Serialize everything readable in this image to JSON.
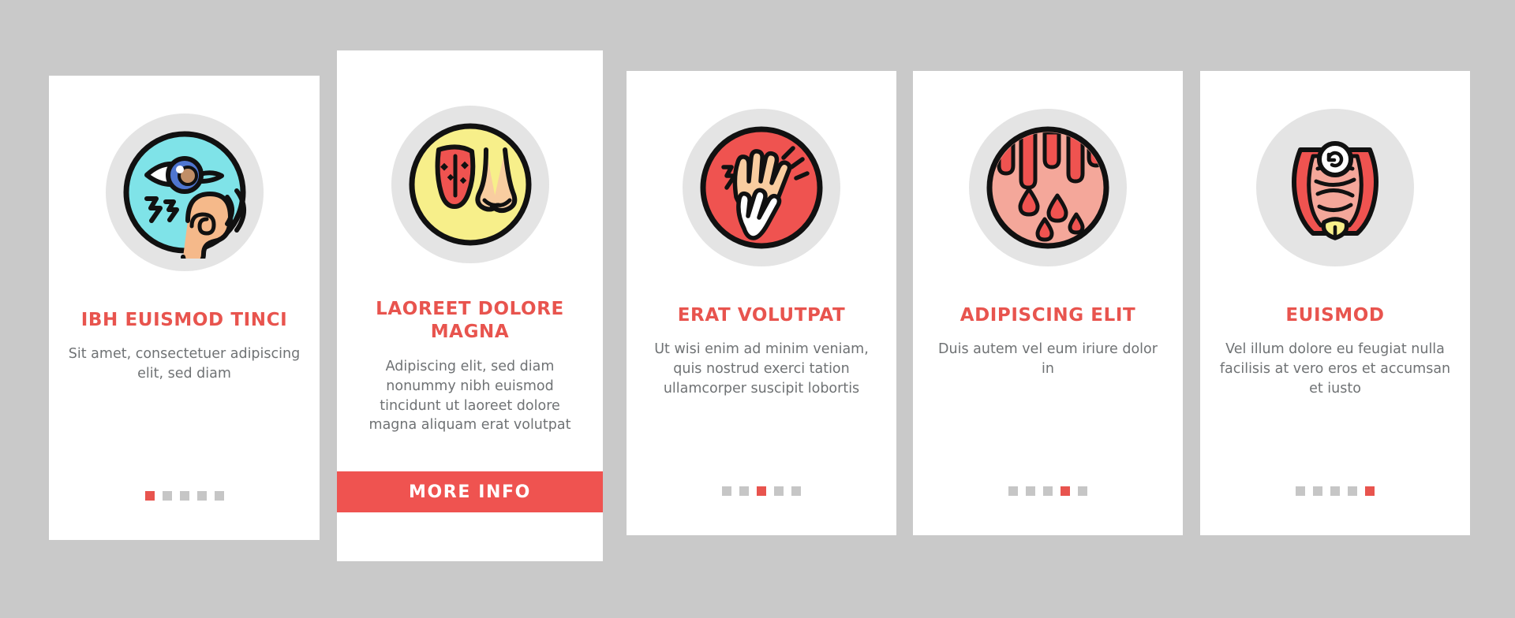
{
  "background_color": "#c9c9c9",
  "accent_color": "#e8544e",
  "button_color": "#ef5350",
  "text_color": "#6f7274",
  "icon_disc_color": "#e4e4e4",
  "cards": [
    {
      "id": "card-1",
      "icon_name": "eye-ear-sensory-icon",
      "icon_bg": "#7fe3e8",
      "title": "IBH EUISMOD TINCI",
      "description": "Sit amet, consectetuer adipiscing elit, sed diam",
      "featured": false,
      "pagination": {
        "total": 5,
        "active_index": 0
      }
    },
    {
      "id": "card-2",
      "icon_name": "tongue-nose-icon",
      "icon_bg": "#f7ef8a",
      "title": "LAOREET DOLORE MAGNA",
      "description": "Adipiscing elit, sed diam nonummy nibh euismod tincidunt ut laoreet dolore magna aliquam erat volutpat",
      "featured": true,
      "button_label": "MORE INFO"
    },
    {
      "id": "card-3",
      "icon_name": "itching-hands-icon",
      "icon_bg": "#ef5350",
      "title": "ERAT VOLUTPAT",
      "description": "Ut wisi enim ad minim veniam, quis nostrud exerci tation ullamcorper suscipit lobortis",
      "featured": false,
      "pagination": {
        "total": 5,
        "active_index": 2
      }
    },
    {
      "id": "card-4",
      "icon_name": "blood-drops-skin-icon",
      "icon_bg": "#f4a79a",
      "title": "ADIPISCING ELIT",
      "description": "Duis autem vel eum iriure dolor in",
      "featured": false,
      "pagination": {
        "total": 5,
        "active_index": 3
      }
    },
    {
      "id": "card-5",
      "icon_name": "intestines-digestive-icon",
      "icon_bg": "#ffffff",
      "title": "EUISMOD",
      "description": "Vel illum dolore eu feugiat nulla facilisis at vero eros et accumsan et iusto",
      "featured": false,
      "pagination": {
        "total": 5,
        "active_index": 4
      }
    }
  ]
}
